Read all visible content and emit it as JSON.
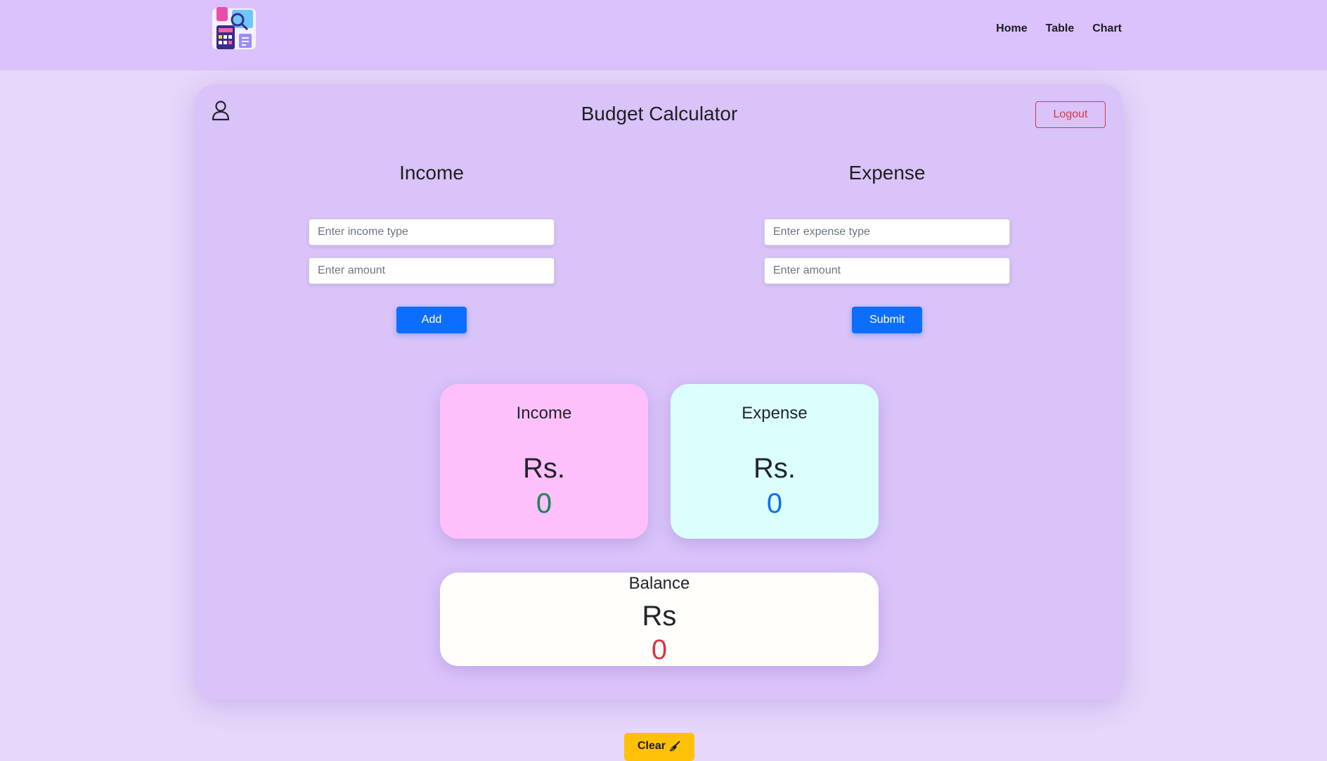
{
  "nav": {
    "links": [
      "Home",
      "Table",
      "Chart"
    ]
  },
  "main": {
    "title": "Budget Calculator",
    "logout_label": "Logout"
  },
  "income_form": {
    "heading": "Income",
    "type_placeholder": "Enter income type",
    "amount_placeholder": "Enter amount",
    "button_label": "Add"
  },
  "expense_form": {
    "heading": "Expense",
    "type_placeholder": "Enter expense type",
    "amount_placeholder": "Enter amount",
    "button_label": "Submit"
  },
  "summary": {
    "income": {
      "title": "Income",
      "currency": "Rs.",
      "value": "0"
    },
    "expense": {
      "title": "Expense",
      "currency": "Rs.",
      "value": "0"
    },
    "balance": {
      "title": "Balance",
      "currency": "Rs",
      "value": "0"
    }
  },
  "footer": {
    "clear_label": "Clear"
  },
  "icons": {
    "logo": "budget-calculator-logo-icon",
    "user": "user-icon",
    "clear": "broom-icon"
  },
  "colors": {
    "navbar": "#dbc2fc",
    "page": "#e6d7fb",
    "card": "#d9c3f9",
    "primary": "#0d6efd",
    "danger": "#dc3545",
    "success": "#198754",
    "warning": "#ffc107",
    "income_card": "#fdc0fb",
    "expense_card": "#dbfffd",
    "balance_card": "#fffefb"
  }
}
